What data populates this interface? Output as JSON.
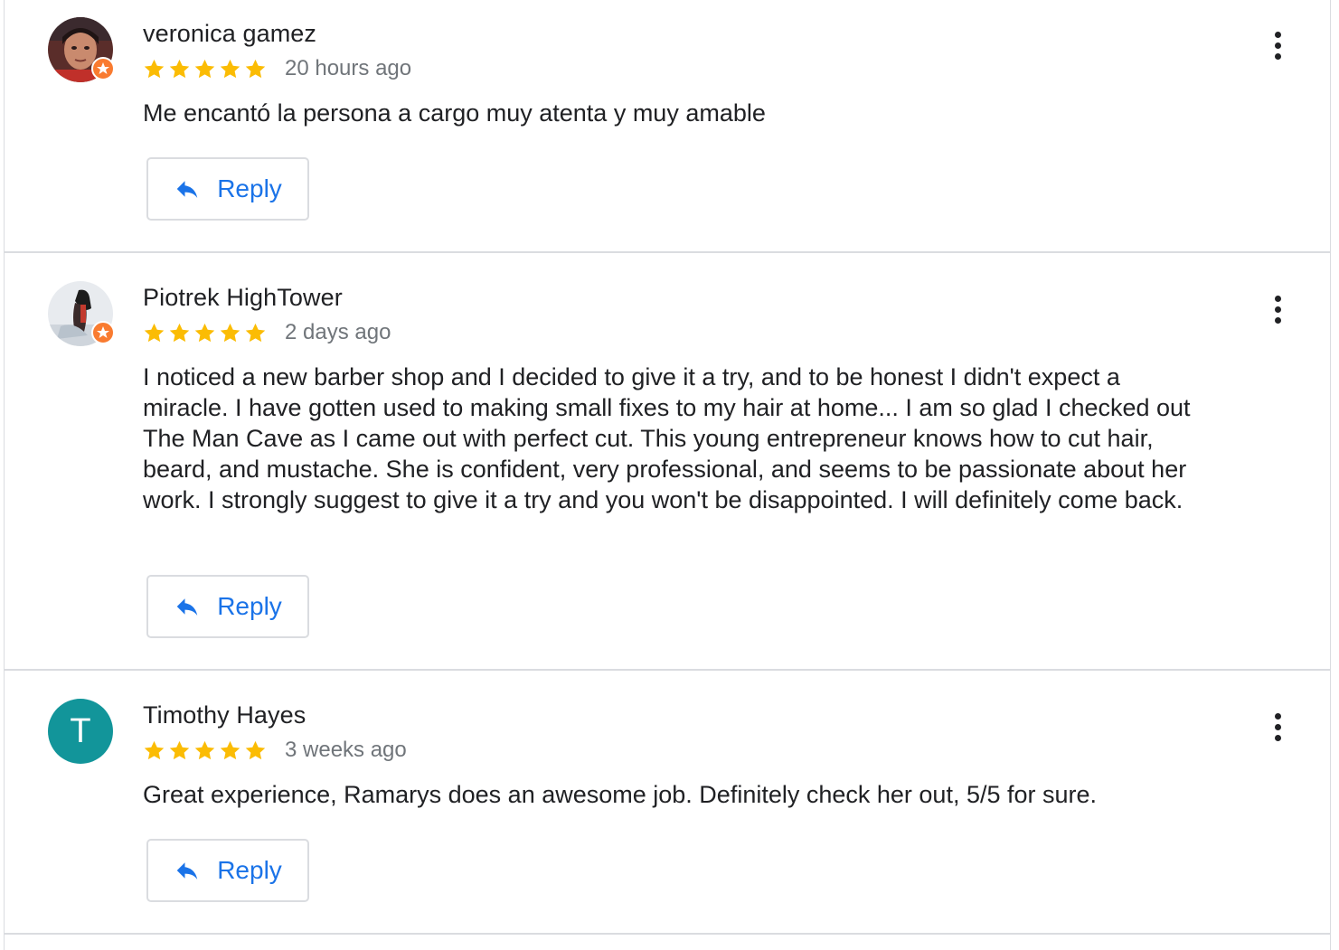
{
  "colors": {
    "star": "#fbbc04",
    "link": "#1a73e8",
    "divider": "#dadce0",
    "avatar_teal": "#12959a",
    "local_guide_badge": "#f97b30"
  },
  "reviews": [
    {
      "author": "veronica gamez",
      "rating": 5,
      "time": "20 hours ago",
      "text": "Me encantó la persona a cargo muy atenta y muy amable",
      "reply_label": "Reply",
      "avatar": "photo",
      "local_guide_badge": true
    },
    {
      "author": "Piotrek HighTower",
      "rating": 5,
      "time": "2 days ago",
      "text": "I noticed a new barber shop and I decided to give it a try, and to be honest I didn't expect a miracle. I have gotten used to making small fixes to my hair at home... I am so glad I checked out The Man Cave as I came out with perfect cut. This young entrepreneur knows how to cut hair, beard, and mustache. She is confident, very professional, and seems to be passionate about her work. I strongly suggest to give it a try and you won't be disappointed. I will definitely come back.",
      "reply_label": "Reply",
      "avatar": "photo",
      "local_guide_badge": true
    },
    {
      "author": "Timothy Hayes",
      "rating": 5,
      "time": "3 weeks ago",
      "text": "Great experience, Ramarys does an awesome job. Definitely check her out, 5/5 for sure.",
      "reply_label": "Reply",
      "avatar": "letter",
      "avatar_letter": "T",
      "local_guide_badge": false
    }
  ],
  "icons": {
    "star": "star-icon",
    "reply": "reply-arrow-icon",
    "more": "more-vertical-icon",
    "badge": "local-guide-badge-icon"
  }
}
